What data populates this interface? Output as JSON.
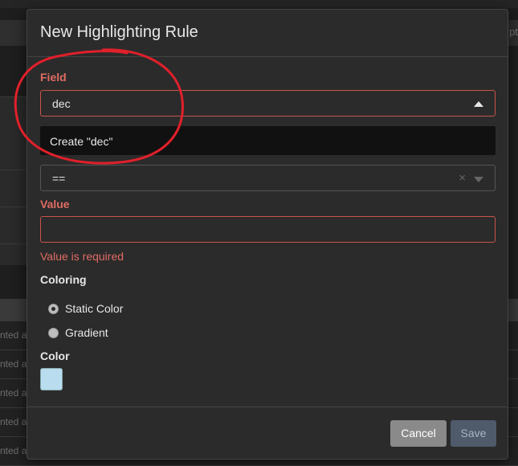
{
  "background": {
    "header_right_text": "pt",
    "row_fragment": "nted a"
  },
  "modal": {
    "title": "New Highlighting Rule",
    "field": {
      "label": "Field",
      "value": "dec",
      "dropdown_option": "Create \"dec\""
    },
    "operator": {
      "value": "==",
      "clear_glyph": "×"
    },
    "value_field": {
      "label": "Value",
      "value": "",
      "error": "Value is required"
    },
    "coloring": {
      "label": "Coloring",
      "options": [
        {
          "label": "Static Color",
          "selected": true
        },
        {
          "label": "Gradient",
          "selected": false
        }
      ]
    },
    "color": {
      "label": "Color",
      "swatch": "#b9dcef"
    },
    "buttons": {
      "cancel": "Cancel",
      "save": "Save"
    }
  },
  "colors": {
    "error": "#e06c63",
    "annotation": "#e0202a"
  }
}
